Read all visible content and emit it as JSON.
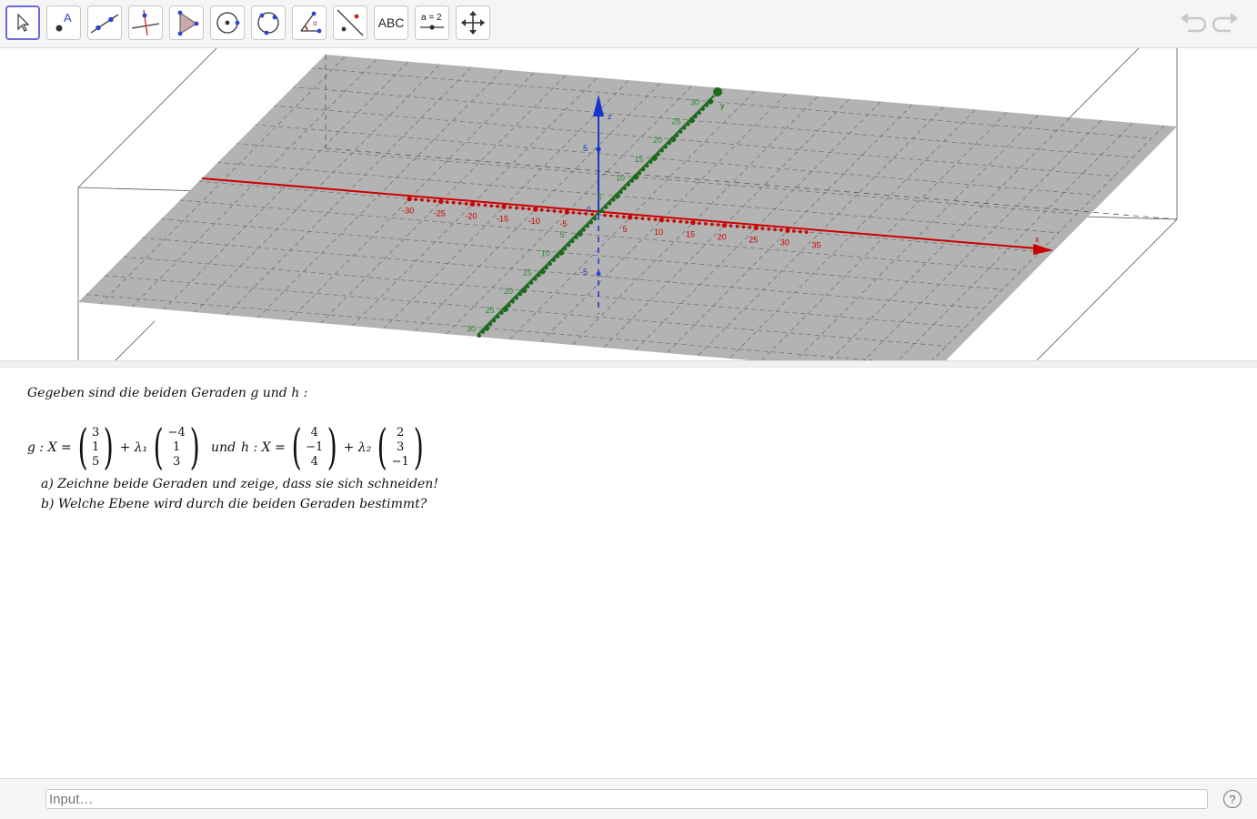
{
  "toolbar": {
    "tools": [
      {
        "name": "move-tool",
        "icon": "pointer-arrow-icon"
      },
      {
        "name": "point-tool",
        "icon": "point-icon",
        "label": "A"
      },
      {
        "name": "line-tool",
        "icon": "line-through-points-icon"
      },
      {
        "name": "perpendicular-line-tool",
        "icon": "perpendicular-line-icon"
      },
      {
        "name": "polygon-tool",
        "icon": "polygon-icon"
      },
      {
        "name": "circle-tool",
        "icon": "circle-center-point-icon"
      },
      {
        "name": "circle-three-points-tool",
        "icon": "circle-three-points-icon"
      },
      {
        "name": "angle-tool",
        "icon": "angle-icon"
      },
      {
        "name": "reflect-tool",
        "icon": "reflect-about-line-icon"
      },
      {
        "name": "text-tool",
        "icon": "text-icon",
        "label": "ABC"
      },
      {
        "name": "slider-tool",
        "icon": "slider-icon",
        "label": "a = 2"
      },
      {
        "name": "move-view-tool",
        "icon": "move-graphics-view-icon"
      }
    ],
    "undo_icon": "undo-icon",
    "redo_icon": "redo-icon"
  },
  "graphics": {
    "x_axis": {
      "label": "x",
      "color": "#cc0000",
      "ticks": [
        "-30",
        "-25",
        "-20",
        "-15",
        "-10",
        "-5",
        "5",
        "10",
        "15",
        "20",
        "25",
        "30",
        "35"
      ]
    },
    "y_axis": {
      "label": "y",
      "color": "#1b6b1b",
      "ticks": [
        "30",
        "25",
        "20",
        "15",
        "10",
        "5",
        "-5",
        "-10",
        "-15",
        "-20",
        "-25",
        "-30"
      ]
    },
    "z_axis": {
      "label": "z",
      "color": "#1a33cc",
      "ticks": [
        "5",
        "-5"
      ]
    },
    "origin": "0",
    "plane_color": "#b3b3b3"
  },
  "text": {
    "intro": "Gegeben sind die beiden Geraden g und h :",
    "g_label": "g : X =",
    "g_point": [
      "3",
      "1",
      "5"
    ],
    "plus_lambda1": "+ λ₁",
    "g_dir": [
      "−4",
      "1",
      "3"
    ],
    "und": "und",
    "h_label": "h : X =",
    "h_point": [
      "4",
      "−1",
      "4"
    ],
    "plus_lambda2": "+ λ₂",
    "h_dir": [
      "2",
      "3",
      "−1"
    ],
    "task_a": "a) Zeichne beide Geraden und zeige, dass sie sich schneiden!",
    "task_b": "b) Welche Ebene wird durch die beiden Geraden bestimmt?"
  },
  "footer": {
    "input_placeholder": "Input…",
    "help": "?"
  }
}
